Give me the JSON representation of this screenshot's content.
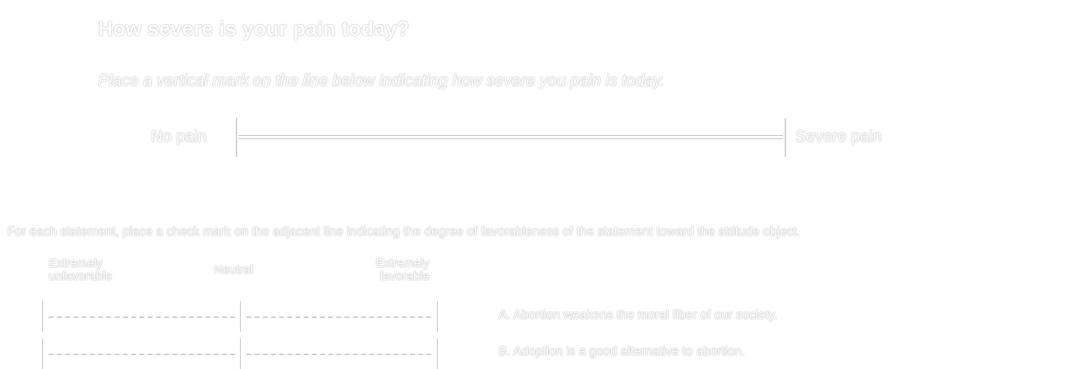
{
  "pain": {
    "question": "How severe is your pain today?",
    "instruction": "Place a vertical mark on the line below indicating how severe you pain is today.",
    "left_anchor": "No pain",
    "right_anchor": "Severe pain"
  },
  "likert": {
    "intro": "For each statement, place a check mark on the adjacent line indicating the degree of favorableness of the statement toward the attitude object.",
    "scale_left_line1": "Extremely",
    "scale_left_line2": "unfavorable",
    "scale_middle": "Neutral",
    "scale_right_line1": "Extremely",
    "scale_right_line2": "favorable",
    "statements": [
      "A. Abortion weakens the moral fiber of our society.",
      "B. Adoption is a good alternative to abortion."
    ]
  }
}
